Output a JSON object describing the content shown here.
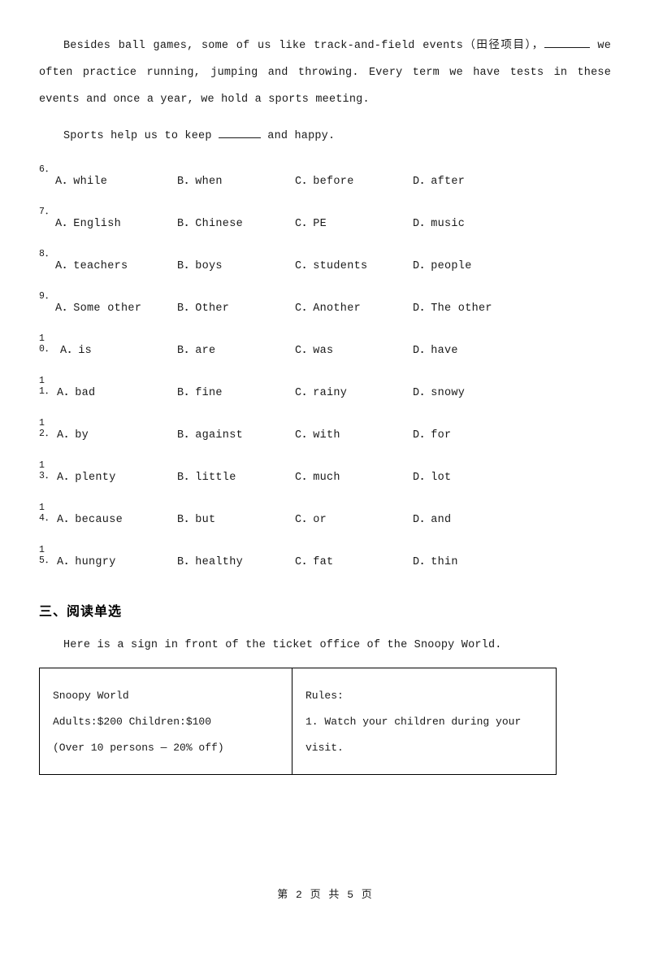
{
  "passage": {
    "para1_part1": "Besides ball games, some of us like track-and-field events",
    "para1_part1b": "（田径项目），",
    "para1_part2": "we often practice running, jumping and throwing. Every term we have tests in these events and once a year, we hold a sports meeting.",
    "para2_part1": "Sports help us to keep",
    "para2_part2": "and happy."
  },
  "questions": [
    {
      "number": "6．",
      "options": [
        "A．while",
        "B．when",
        "C．before",
        "D．after"
      ]
    },
    {
      "number": "7．",
      "options": [
        "A．English",
        "B．Chinese",
        "C．PE",
        "D．music"
      ]
    },
    {
      "number": "8．",
      "options": [
        "A．teachers",
        "B．boys",
        "C．students",
        "D．people"
      ]
    },
    {
      "number": "9．",
      "options": [
        "A．Some other",
        "B．Other",
        "C．Another",
        "D．The other"
      ]
    },
    {
      "number": "10．",
      "options": [
        "A．is",
        "B．are",
        "C．was",
        "D．have"
      ]
    },
    {
      "number": "11．",
      "options": [
        "A．bad",
        "B．fine",
        "C．rainy",
        "D．snowy"
      ]
    },
    {
      "number": "12．",
      "options": [
        "A．by",
        "B．against",
        "C．with",
        "D．for"
      ]
    },
    {
      "number": "13．",
      "options": [
        "A．plenty",
        "B．little",
        "C．much",
        "D．lot"
      ]
    },
    {
      "number": "14．",
      "options": [
        "A．because",
        "B．but",
        "C．or",
        "D．and"
      ]
    },
    {
      "number": "15．",
      "options": [
        "A．hungry",
        "B．healthy",
        "C．fat",
        "D．thin"
      ]
    }
  ],
  "section": {
    "title": "三、阅读单选",
    "lead": "Here is a sign in front of the ticket office of the Snoopy World."
  },
  "sign": {
    "left_line1": "Snoopy World",
    "left_line2": "Adults:$200 Children:$100",
    "left_line3": "(Over 10 persons — 20% off)",
    "right_line1": "Rules:",
    "right_line2": "1. Watch your children during your",
    "right_line3": "visit."
  },
  "footer": "第 2 页 共 5 页"
}
